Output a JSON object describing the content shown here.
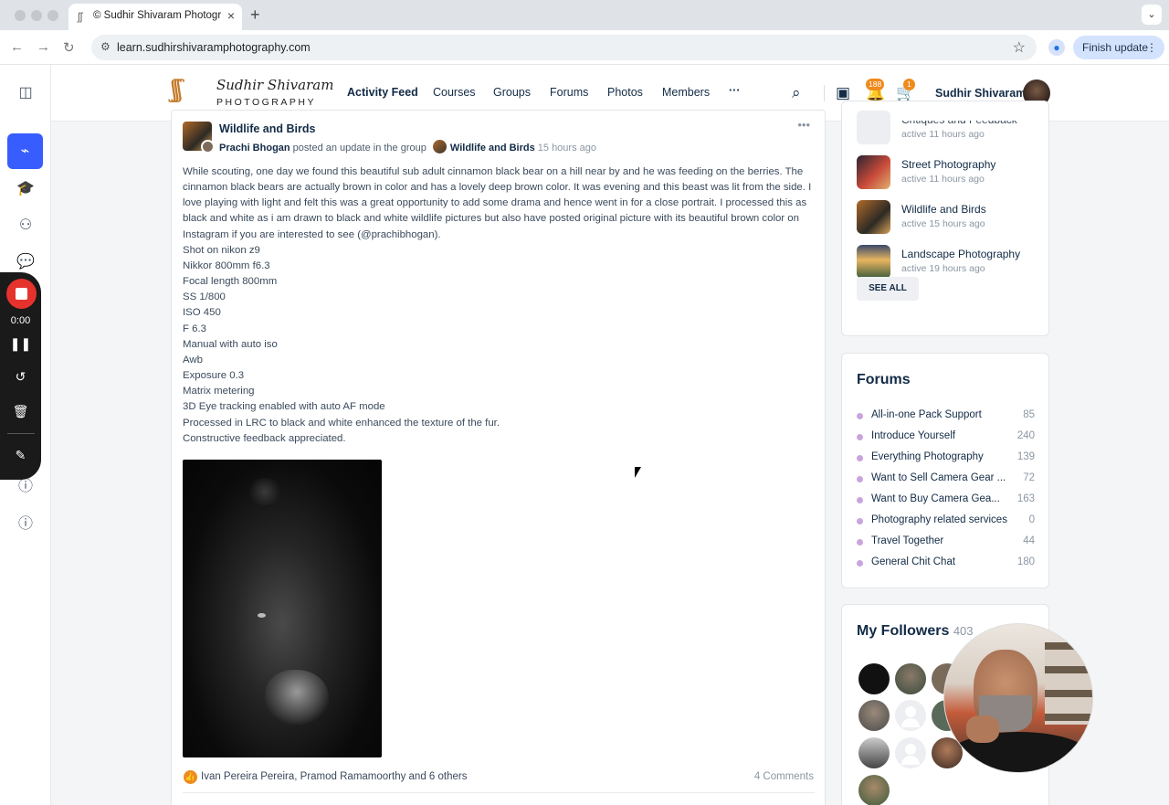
{
  "browser": {
    "tab_title": "© Sudhir Shivaram Photography",
    "url": "learn.sudhirshivaramphotography.com",
    "finish_update": "Finish update"
  },
  "recorder": {
    "time": "0:00"
  },
  "header": {
    "logo_script": "Sudhir Shivaram",
    "logo_sub": "PHOTOGRAPHY",
    "nav": [
      "Activity Feed",
      "Courses",
      "Groups",
      "Forums",
      "Photos",
      "Members"
    ],
    "notif_count": "188",
    "cart_count": "1",
    "username": "Sudhir Shivaram"
  },
  "post": {
    "group": "Wildlife and Birds",
    "author": "Prachi Bhogan",
    "action": " posted an update in the group ",
    "group_link": "Wildlife and Birds",
    "time": " 15 hours ago",
    "body": [
      "While scouting, one day we found this beautiful sub adult cinnamon black bear on a hill near by and he was feeding on the berries. The cinnamon black bears are actually brown in color and has a lovely deep brown color. It was evening and this beast was lit from the side. I love playing with light and felt this was a great opportunity to add some drama and hence went in for a close portrait. I processed this as black and white as i am drawn to black and white wildlife pictures but also have posted original picture with its beautiful brown color on Instagram if you are interested to see (@prachibhogan).",
      "Shot on nikon z9",
      "Nikkor 800mm f6.3",
      "Focal length 800mm",
      "SS 1/800",
      "ISO 450",
      "F 6.3",
      "Manual with auto iso",
      "Awb",
      "Exposure 0.3",
      "Matrix metering",
      "3D Eye tracking enabled with auto AF mode",
      "Processed in LRC to black and white enhanced the texture of the fur.",
      "Constructive feedback appreciated."
    ],
    "reactors": "Ivan Pereira Pereira, Pramod Ramamoorthy and 6 others",
    "comments": "4 Comments"
  },
  "groups_widget": {
    "items": [
      {
        "name": "Critiques and Feedback",
        "active": "active 11 hours ago"
      },
      {
        "name": "Street Photography",
        "active": "active 11 hours ago"
      },
      {
        "name": "Wildlife and Birds",
        "active": "active 15 hours ago"
      },
      {
        "name": "Landscape Photography",
        "active": "active 19 hours ago"
      }
    ],
    "see_all": "SEE ALL"
  },
  "forums_widget": {
    "title": "Forums",
    "items": [
      {
        "name": "All-in-one Pack Support",
        "count": "85"
      },
      {
        "name": "Introduce Yourself",
        "count": "240"
      },
      {
        "name": "Everything Photography",
        "count": "139"
      },
      {
        "name": "Want to Sell Camera Gear ...",
        "count": "72"
      },
      {
        "name": "Want to Buy Camera Gea...",
        "count": "163"
      },
      {
        "name": "Photography related services",
        "count": "0"
      },
      {
        "name": "Travel Together",
        "count": "44"
      },
      {
        "name": "General Chit Chat",
        "count": "180"
      }
    ]
  },
  "followers_widget": {
    "title": "My Followers",
    "count": "403"
  }
}
